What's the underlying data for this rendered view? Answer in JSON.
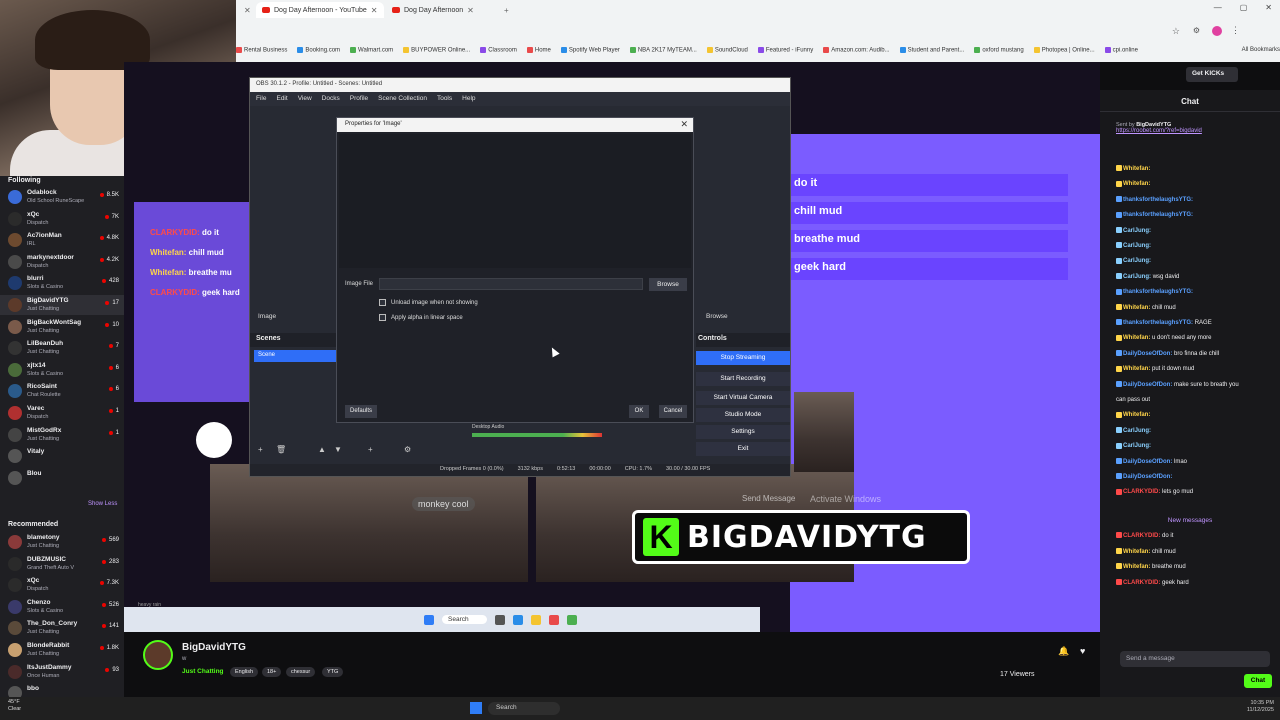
{
  "browser": {
    "tabs": [
      {
        "label": "Dog Day Afternoon - YouTube"
      },
      {
        "label": "Dog Day Afternoon"
      }
    ],
    "search_placeholder": "Search",
    "bookmarks": [
      "Rental Business",
      "Booking.com",
      "Walmart.com",
      "BUYPOWER Online...",
      "Classroom",
      "Home",
      "Spotify Web Player",
      "NBA 2K17 MyTEAM...",
      "SoundCloud",
      "Featured - iFunny",
      "Amazon.com: Audib...",
      "Student and Parent...",
      "oxford mustang",
      "Photopea | Online...",
      "cpi.online"
    ],
    "all_bookmarks": "All Bookmarks"
  },
  "sidebar": {
    "following_header": "Following",
    "channels": [
      {
        "name": "Odablock",
        "game": "Old School RuneScape",
        "viewers": "8.5K",
        "color": "#3a6bd8"
      },
      {
        "name": "xQc",
        "game": "Dispatch",
        "viewers": "7K",
        "color": "#2b2b2b"
      },
      {
        "name": "Ac7ionMan",
        "game": "IRL",
        "viewers": "4.8K",
        "color": "#6d4a2f"
      },
      {
        "name": "markynextdoor",
        "game": "Dispatch",
        "viewers": "4.2K",
        "color": "#4a4a4a"
      },
      {
        "name": "blurri",
        "game": "Slots & Casino",
        "viewers": "428",
        "color": "#1e3a6e"
      },
      {
        "name": "BigDavidYTG",
        "game": "Just Chatting",
        "viewers": "17",
        "color": "#5c3a2a"
      },
      {
        "name": "BigBackWontSag",
        "game": "Just Chatting",
        "viewers": "10",
        "color": "#7a5a4a"
      },
      {
        "name": "LilBeanDuh",
        "game": "Just Chatting",
        "viewers": "7",
        "color": "#333"
      },
      {
        "name": "xjtx14",
        "game": "Slots & Casino",
        "viewers": "6",
        "color": "#4a6b3a"
      },
      {
        "name": "RicoSaint",
        "game": "Chat Roulette",
        "viewers": "6",
        "color": "#2a5a8a"
      },
      {
        "name": "Varec",
        "game": "Dispatch",
        "viewers": "1",
        "color": "#b03030"
      },
      {
        "name": "MistGodRx",
        "game": "Just Chatting",
        "viewers": "1",
        "color": "#444"
      },
      {
        "name": "Vitaly",
        "game": "",
        "viewers": "",
        "color": "#555"
      },
      {
        "name": "Blou",
        "game": "",
        "viewers": "",
        "color": "#555"
      }
    ],
    "show_less": "Show Less",
    "recommended_header": "Recommended",
    "recommended": [
      {
        "name": "blametony",
        "game": "Just Chatting",
        "viewers": "569",
        "color": "#8a3a3a"
      },
      {
        "name": "DUBZMUSIC",
        "game": "Grand Theft Auto V",
        "viewers": "283",
        "color": "#2a2a2a"
      },
      {
        "name": "xQc",
        "game": "Dispatch",
        "viewers": "7.3K",
        "color": "#2b2b2b"
      },
      {
        "name": "Chenzo",
        "game": "Slots & Casino",
        "viewers": "526",
        "color": "#3a3a6a"
      },
      {
        "name": "The_Don_Conry",
        "game": "Just Chatting",
        "viewers": "141",
        "color": "#5a4a3a"
      },
      {
        "name": "BlondeRabbit",
        "game": "Just Chatting",
        "viewers": "1.8K",
        "color": "#c8a070"
      },
      {
        "name": "ItsJustDammy",
        "game": "Once Human",
        "viewers": "93",
        "color": "#4a2a2a"
      },
      {
        "name": "bbo",
        "game": "",
        "viewers": "",
        "color": "#555"
      }
    ]
  },
  "obs": {
    "title": "OBS 30.1.2 - Profile: Untitled - Scenes: Untitled",
    "menu": [
      "File",
      "Edit",
      "View",
      "Docks",
      "Profile",
      "Scene Collection",
      "Tools",
      "Help"
    ],
    "image_tab": "Image",
    "browse_tab": "Browse",
    "scenes_header": "Scenes",
    "scene_item": "Scene",
    "controls_header": "Controls",
    "controls": [
      "Stop Streaming",
      "Start Recording",
      "Start Virtual Camera",
      "Studio Mode",
      "Settings",
      "Exit"
    ],
    "desktop_audio": "Desktop Audio",
    "status": [
      "Dropped Frames 0 (0.0%)",
      "3132 kbps",
      "0:52:13",
      "00:00:00",
      "CPU: 1.7%",
      "30.00 / 30.00 FPS"
    ]
  },
  "properties_dialog": {
    "title": "Properties for 'Image'",
    "image_file_label": "Image File",
    "image_file_value": "",
    "browse": "Browse",
    "unload_label": "Unload image when not showing",
    "alpha_label": "Apply alpha in linear space",
    "defaults": "Defaults",
    "ok": "OK",
    "cancel": "Cancel"
  },
  "stream_overlay": {
    "chat_lines": [
      {
        "user": "CLARKYDID:",
        "text": "do it",
        "color": "#ff4a4a"
      },
      {
        "user": "Whitefan:",
        "text": "chill mud",
        "color": "#ffd54a"
      },
      {
        "user": "Whitefan:",
        "text": "breathe mu",
        "color": "#ffd54a"
      },
      {
        "user": "CLARKYDID:",
        "text": "geek hard",
        "color": "#ff4a4a"
      }
    ],
    "big_lines": [
      "do it",
      "chill mud",
      "breathe mud",
      "geek hard"
    ],
    "monkey_caption": "monkey cool",
    "send_message": "Send Message",
    "activate_windows": "Activate Windows",
    "banner": "BIGDAVIDYTG",
    "banner_k": "K",
    "inner_search": "Search",
    "away": "heavy rain\nTomorrow"
  },
  "chat": {
    "title": "Chat",
    "get_kicks": "Get KICKs",
    "pinned_by": "Sent by",
    "pinned_user": "BigDavidYTG",
    "pinned_link": "https://roobet.com/?ref=bigdavid",
    "messages": [
      {
        "user": "Whitefan:",
        "text": "",
        "color": "#ffd54a"
      },
      {
        "user": "Whitefan:",
        "text": "",
        "color": "#ffd54a"
      },
      {
        "user": "thanksfortheIaughsYTG:",
        "text": "",
        "color": "#5aa0ff"
      },
      {
        "user": "thanksfortheIaughsYTG:",
        "text": "",
        "color": "#5aa0ff"
      },
      {
        "user": "CarlJung:",
        "text": "",
        "color": "#8ad0ff"
      },
      {
        "user": "CarlJung:",
        "text": "",
        "color": "#8ad0ff"
      },
      {
        "user": "CarlJung:",
        "text": "",
        "color": "#8ad0ff"
      },
      {
        "user": "CarlJung:",
        "text": "wsg david",
        "color": "#8ad0ff"
      },
      {
        "user": "thanksfortheIaughsYTG:",
        "text": "",
        "color": "#5aa0ff"
      },
      {
        "user": "Whitefan:",
        "text": "chill mud",
        "color": "#ffd54a"
      },
      {
        "user": "thanksfortheIaughsYTG:",
        "text": "RAGE",
        "color": "#5aa0ff"
      },
      {
        "user": "Whitefan:",
        "text": "u don't need any more",
        "color": "#ffd54a"
      },
      {
        "user": "DailyDoseOfDon:",
        "text": "bro finna die chill",
        "color": "#5aa0ff"
      },
      {
        "user": "Whitefan:",
        "text": "put it down mud",
        "color": "#ffd54a"
      },
      {
        "user": "DailyDoseOfDon:",
        "text": "make sure to breath you",
        "color": "#5aa0ff"
      },
      {
        "user": "",
        "text": "can pass out",
        "color": "#efeff1"
      },
      {
        "user": "Whitefan:",
        "text": "",
        "color": "#ffd54a"
      },
      {
        "user": "CarlJung:",
        "text": "",
        "color": "#8ad0ff"
      },
      {
        "user": "CarlJung:",
        "text": "",
        "color": "#8ad0ff"
      },
      {
        "user": "DailyDoseOfDon:",
        "text": "lmao",
        "color": "#5aa0ff"
      },
      {
        "user": "DailyDoseOfDon:",
        "text": "",
        "color": "#5aa0ff"
      },
      {
        "user": "CLARKYDID:",
        "text": "lets go mud",
        "color": "#ff4a4a"
      }
    ],
    "new_messages": "New messages",
    "new_msgs": [
      {
        "user": "CLARKYDID:",
        "text": "do it",
        "color": "#ff4a4a"
      },
      {
        "user": "Whitefan:",
        "text": "chill mud",
        "color": "#ffd54a"
      },
      {
        "user": "Whitefan:",
        "text": "breathe mud",
        "color": "#ffd54a"
      },
      {
        "user": "CLARKYDID:",
        "text": "geek hard",
        "color": "#ff4a4a"
      }
    ],
    "input_placeholder": "Send a message",
    "chat_button": "Chat"
  },
  "channel_info": {
    "name": "BigDavidYTG",
    "subtitle": "w",
    "category": "Just Chatting",
    "tags": [
      "English",
      "18+",
      "chessur",
      "YTG"
    ],
    "viewers": "17 Viewers"
  },
  "taskbar": {
    "search": "Search",
    "temp": "45°F",
    "weather": "Clear",
    "time": "10:35 PM",
    "date": "11/12/2025"
  }
}
